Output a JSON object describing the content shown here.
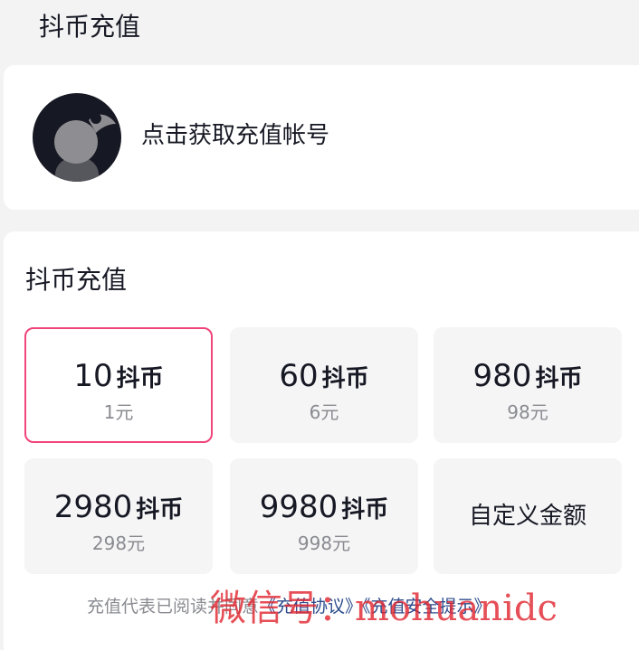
{
  "page": {
    "title": "抖币充值"
  },
  "account": {
    "link_text": "点击获取充值帐号"
  },
  "recharge": {
    "section_title": "抖币充值",
    "unit": "抖币",
    "options": [
      {
        "amount": "10",
        "price": "1元",
        "selected": true
      },
      {
        "amount": "60",
        "price": "6元"
      },
      {
        "amount": "980",
        "price": "98元"
      },
      {
        "amount": "2980",
        "price": "298元"
      },
      {
        "amount": "9980",
        "price": "998元"
      }
    ],
    "custom_label": "自定义金额"
  },
  "agreement": {
    "prefix": "充值代表已阅读并同意",
    "link_agreement": "《充值协议》",
    "link_safety": "《充值安全提示》"
  },
  "watermark": {
    "text": "微信号：mohuanidc"
  },
  "colors": {
    "selected_border": "#f0447a",
    "link": "#2c4b8c",
    "watermark": "#e12832"
  }
}
